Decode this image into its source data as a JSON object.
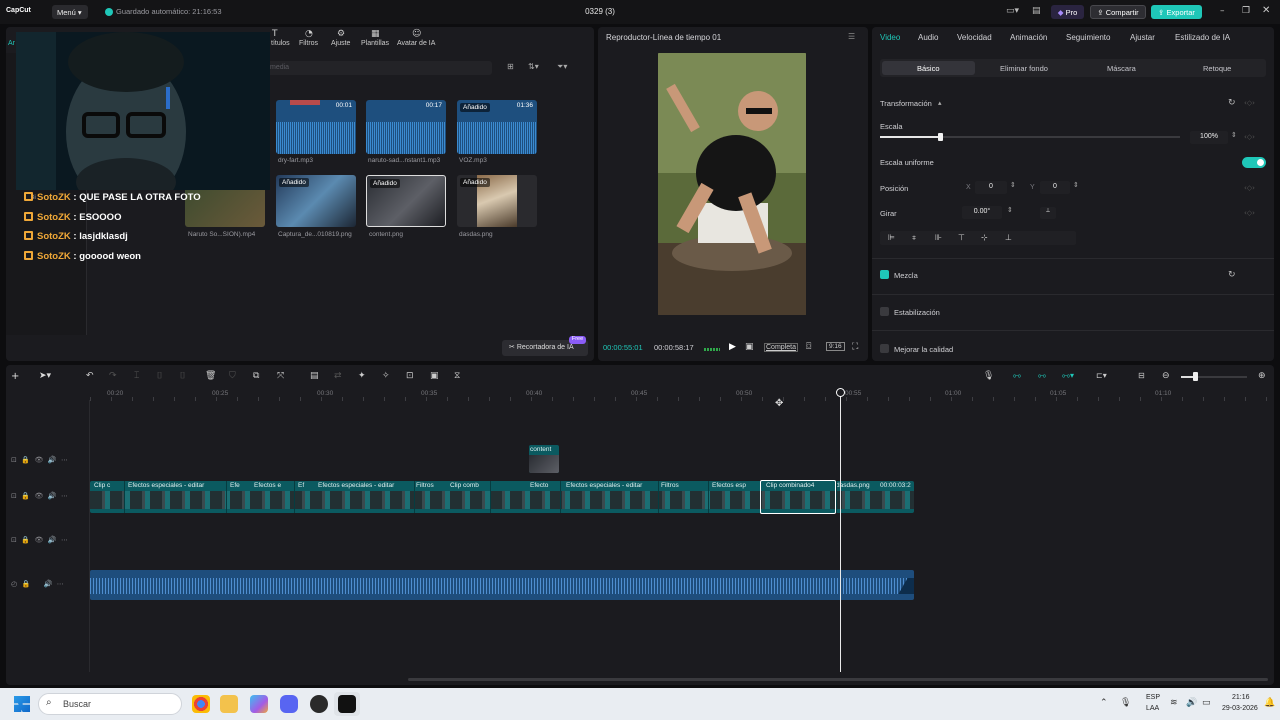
{
  "titlebar": {
    "logo": "CapCut",
    "menu": "Menú",
    "autosave": "Guardado automático: 21:16:53",
    "project": "0329 (3)",
    "pro": "Pro",
    "share": "Compartir",
    "export": "Exportar"
  },
  "media": {
    "tabs": [
      "Ar",
      "títulos",
      "Filtros",
      "Ajuste",
      "Plantillas",
      "Avatar de IA"
    ],
    "search_placeholder": "media",
    "items": [
      {
        "name": "dry-fart.mp3",
        "duration": "00:01",
        "added": ""
      },
      {
        "name": "naruto-sad...nstant1.mp3",
        "duration": "00:17",
        "added": ""
      },
      {
        "name": "VOZ.mp3",
        "duration": "01:36",
        "added": "Añadido"
      },
      {
        "name": "Naruto So...SION).mp4",
        "duration": "",
        "added": ""
      },
      {
        "name": "Captura_de...010819.png",
        "duration": "",
        "added": "Añadido"
      },
      {
        "name": "content.png",
        "duration": "",
        "added": "Añadido"
      },
      {
        "name": "dasdas.png",
        "duration": "",
        "added": "Añadido"
      }
    ],
    "left_label": "Bi",
    "ai_cutout": "Recortadora de IA",
    "free": "Free"
  },
  "player": {
    "title": "Reproductor-Línea de tiempo 01",
    "current": "00:00:55:01",
    "total": "00:00:58:17",
    "full": "Completa",
    "ratio": "9:16"
  },
  "inspector": {
    "tabs": [
      "Video",
      "Audio",
      "Velocidad",
      "Animación",
      "Seguimiento",
      "Ajustar",
      "Estilizado de IA"
    ],
    "subtabs": [
      "Básico",
      "Eliminar fondo",
      "Máscara",
      "Retoque"
    ],
    "transform": "Transformación",
    "scale": "Escala",
    "scale_value": "100%",
    "scale_fraction": 1.0,
    "uniform": "Escala uniforme",
    "position": "Posición",
    "x_label": "X",
    "x": "0",
    "y_label": "Y",
    "y": "0",
    "rotate": "Girar",
    "rotate_value": "0.00°",
    "blend": "Mezcla",
    "stabilize": "Estabilización",
    "enhance": "Mejorar la calidad",
    "accent": "#1fc7b8"
  },
  "timeline": {
    "ticks": [
      "00:20",
      "00:25",
      "00:30",
      "00:35",
      "00:40",
      "00:45",
      "00:50",
      "00:55",
      "01:00",
      "01:05",
      "01:10"
    ],
    "overlay_clip": "content",
    "clips": [
      "Clip c",
      "Efectos especiales - editar",
      "Efe",
      "Efectos e",
      "Ef",
      "Efectos especiales - editar",
      "Filtros",
      "Clip comb",
      "Efecto",
      "Efectos especiales - editar",
      "Filtros",
      "Efectos esp",
      "Clip combinado4",
      "dasdas.png",
      "00:00:03:2"
    ]
  },
  "chat": [
    {
      "user": "SotoZK",
      "msg": "QUE PASE LA OTRA FOTO"
    },
    {
      "user": "SotoZK",
      "msg": "ESOOOO"
    },
    {
      "user": "SotoZK",
      "msg": "lasjdklasdj"
    },
    {
      "user": "SotoZK",
      "msg": "gooood weon"
    }
  ],
  "taskbar": {
    "search": "Buscar",
    "lang1": "ESP",
    "lang2": "LAA",
    "time": "21:16",
    "date": "29-03-2026"
  }
}
